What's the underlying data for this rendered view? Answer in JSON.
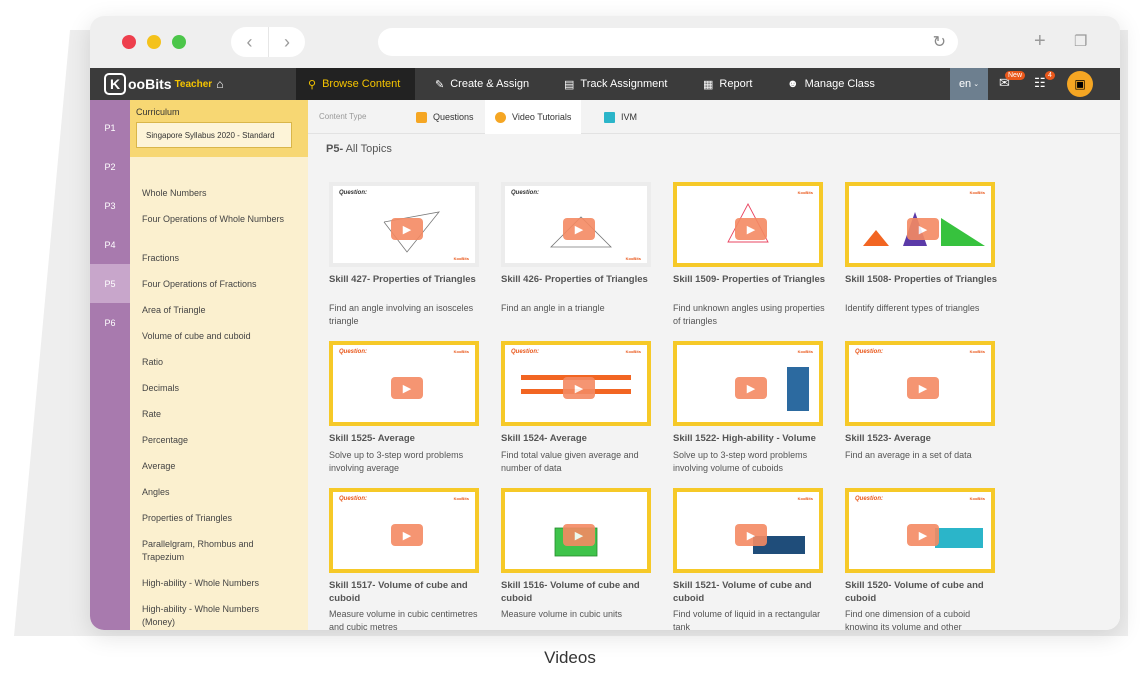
{
  "nav": {
    "logo_k": "K",
    "logo_text": "ooBits",
    "logo_sub": "Teacher",
    "items": [
      "Browse Content",
      "Create & Assign",
      "Track Assignment",
      "Report",
      "Manage Class"
    ],
    "lang": "en",
    "new_badge": "New",
    "cart_count": "4"
  },
  "grades": [
    "P1",
    "P2",
    "P3",
    "P4",
    "P5",
    "P6"
  ],
  "curriculum": {
    "title": "Curriculum",
    "selected": "Singapore Syllabus 2020 - Standard",
    "topics": [
      "Whole Numbers",
      "Four Operations of Whole Numbers",
      "Fractions",
      "Four Operations of Fractions",
      "Area of Triangle",
      "Volume of cube and cuboid",
      "Ratio",
      "Decimals",
      "Rate",
      "Percentage",
      "Average",
      "Angles",
      "Properties of Triangles",
      "Parallelgram, Rhombus and Trapezium",
      "High-ability - Whole Numbers",
      "High-ability - Whole Numbers (Money)"
    ]
  },
  "content": {
    "type_label": "Content Type",
    "tabs": [
      "Questions",
      "Video Tutorials",
      "IVM"
    ],
    "section_prefix": "P5-",
    "section_title": "All Topics",
    "cards": [
      {
        "title": "Skill 427- Properties of Triangles",
        "desc": "Find an angle involving an isosceles triangle"
      },
      {
        "title": "Skill 426- Properties of Triangles",
        "desc": "Find an angle in a triangle"
      },
      {
        "title": "Skill 1509- Properties of Triangles",
        "desc": "Find unknown angles using properties of triangles"
      },
      {
        "title": "Skill 1508- Properties of Triangles",
        "desc": "Identify different types of triangles"
      },
      {
        "title": "Skill 1525- Average",
        "desc": "Solve up to 3-step word problems involving average"
      },
      {
        "title": "Skill 1524- Average",
        "desc": "Find total value given average and number of data"
      },
      {
        "title": "Skill 1522- High-ability - Volume",
        "desc": "Solve up to 3-step word problems involving volume of cuboids"
      },
      {
        "title": "Skill 1523- Average",
        "desc": "Find an average in a set of data"
      },
      {
        "title": "Skill 1517- Volume of cube and cuboid",
        "desc": "Measure volume in cubic centimetres and cubic metres"
      },
      {
        "title": "Skill 1516- Volume of cube and cuboid",
        "desc": "Measure volume in cubic units"
      },
      {
        "title": "Skill 1521- Volume of cube and cuboid",
        "desc": "Find volume of liquid in a rectangular tank"
      },
      {
        "title": "Skill 1520- Volume of cube and cuboid",
        "desc": "Find one dimension of a cuboid knowing its volume and other dimensions"
      }
    ],
    "thumb_question": "Question:",
    "thumb_brand": "KooBits"
  },
  "caption": "Videos",
  "colors": {
    "nav_bg": "#3b3b3b",
    "accent": "#f5c400",
    "grades_bg": "#a87aae",
    "curriculum_bg": "#fbf0cf",
    "thumb_border": "#f6c928"
  }
}
